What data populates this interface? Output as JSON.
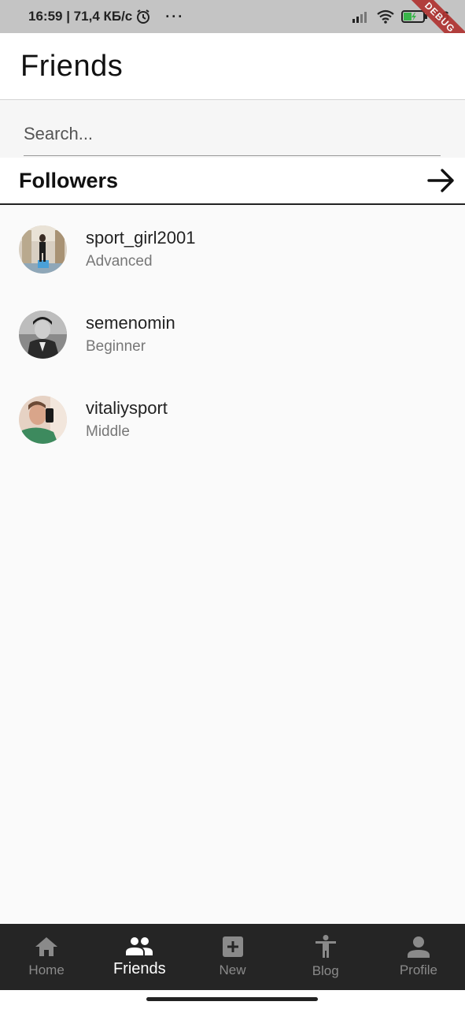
{
  "status_bar": {
    "time_info": "16:59 | 71,4 КБ/с",
    "more": "···",
    "battery": "36",
    "debug_label": "DEBUG"
  },
  "app_bar": {
    "title": "Friends"
  },
  "search": {
    "placeholder": "Search..."
  },
  "followers": {
    "title": "Followers",
    "arrow_icon": "arrow-right-icon",
    "items": [
      {
        "username": "sport_girl2001",
        "level": "Advanced",
        "avatar": "photo-avatar"
      },
      {
        "username": "semenomin",
        "level": "Beginner",
        "avatar": "photo-avatar"
      },
      {
        "username": "vitaliysport",
        "level": "Middle",
        "avatar": "photo-avatar"
      }
    ]
  },
  "bottom_nav": {
    "active": "Friends",
    "items": [
      {
        "label": "Home",
        "icon": "home-icon"
      },
      {
        "label": "Friends",
        "icon": "people-icon"
      },
      {
        "label": "New",
        "icon": "add-box-icon"
      },
      {
        "label": "Blog",
        "icon": "accessibility-icon"
      },
      {
        "label": "Profile",
        "icon": "person-icon"
      }
    ]
  },
  "colors": {
    "nav_background": "#252525",
    "nav_active": "#ffffff",
    "nav_inactive": "#8a8a8a",
    "debug_ribbon": "#b0302e"
  }
}
